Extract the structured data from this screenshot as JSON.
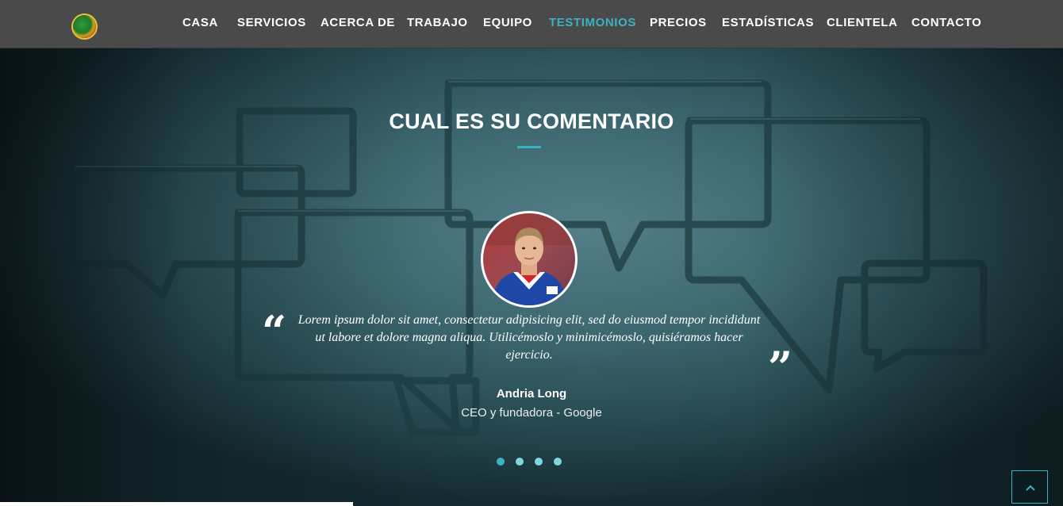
{
  "nav": {
    "logo_icon": "globe-logo-icon",
    "items": [
      {
        "label": "CASA",
        "active": false
      },
      {
        "label": "SERVICIOS",
        "active": false
      },
      {
        "label": "ACERCA DE",
        "active": false
      },
      {
        "label": "TRABAJO",
        "active": false
      },
      {
        "label": "EQUIPO",
        "active": false
      },
      {
        "label": "TESTIMONIOS",
        "active": true
      },
      {
        "label": "PRECIOS",
        "active": false
      },
      {
        "label": "ESTADÍSTICAS",
        "active": false
      },
      {
        "label": "CLIENTELA",
        "active": false
      },
      {
        "label": "CONTACTO",
        "active": false
      }
    ]
  },
  "section": {
    "title": "CUAL ES SU COMENTARIO"
  },
  "testimonial": {
    "quote": "Lorem ipsum dolor sit amet, consectetur adipisicing elit, sed do eiusmod tempor incididunt ut labore et dolore magna aliqua. Utilicémoslo y minimicémoslo, quisiéramos hacer ejercicio.",
    "name": "Andria Long",
    "role": "CEO y fundadora - Google"
  },
  "carousel": {
    "slide_count": 4,
    "active_index": 0
  },
  "colors": {
    "accent": "#3bb3c3",
    "navbar": "#4a4a4a",
    "dot": "#7fd7e2"
  },
  "icons": {
    "back_to_top": "chevron-up-icon",
    "quote_open": "quote-open-icon",
    "quote_close": "quote-close-icon"
  }
}
